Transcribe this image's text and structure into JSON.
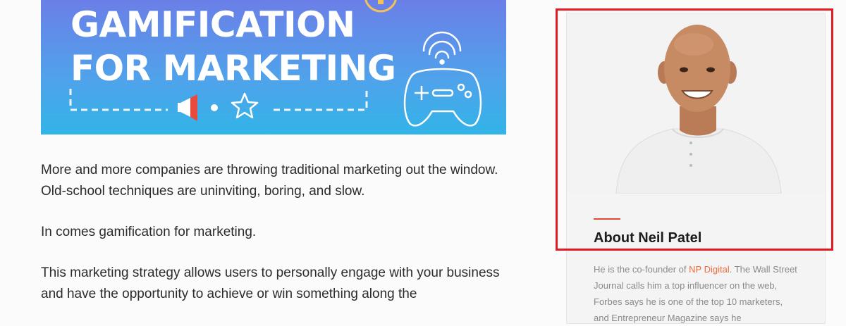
{
  "hero": {
    "title": "GAMIFICATION\nFOR MARKETING",
    "icons": [
      "trophy-icon",
      "megaphone-icon",
      "star-icon",
      "wifi-icon",
      "gamepad-icon"
    ]
  },
  "article": {
    "paragraphs": [
      "More and more companies are throwing traditional marketing out the window. Old-school techniques are uninviting, boring, and slow.",
      "In comes gamification for marketing.",
      "This marketing strategy allows users to personally engage with your business and have the opportunity to achieve or win something along the"
    ]
  },
  "sidebar": {
    "title": "About Neil Patel",
    "bio_before_link": "He is the co-founder of ",
    "bio_link": "NP Digital",
    "bio_after_link": ". The Wall Street Journal calls him a top influencer on the web, Forbes says he is one of the top 10 marketers, and Entrepreneur Magazine says he",
    "accent_color": "#e24a33",
    "link_color": "#f26b3a"
  },
  "highlight_color": "#e21b23"
}
